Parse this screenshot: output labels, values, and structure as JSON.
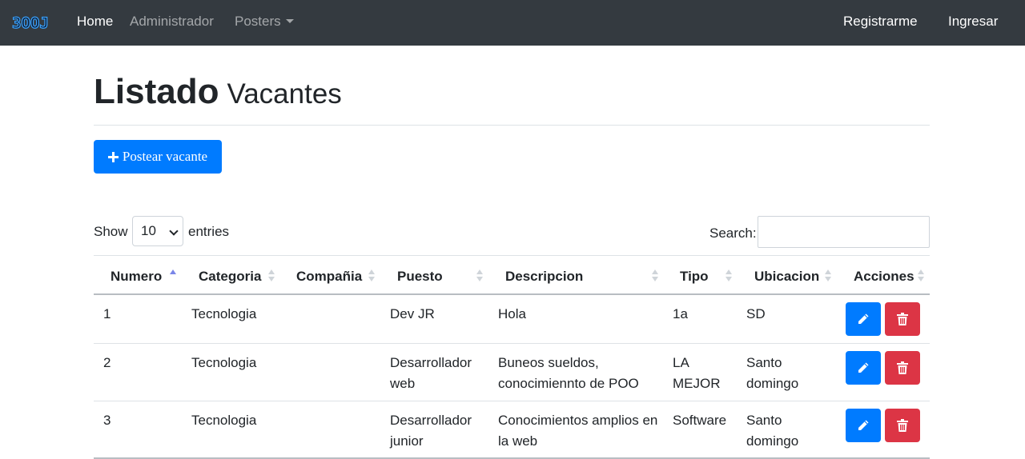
{
  "navbar": {
    "brand": "3OOJ",
    "links": {
      "home": "Home",
      "admin": "Administrador",
      "posters": "Posters"
    },
    "right": {
      "register": "Registrarme",
      "login": "Ingresar"
    }
  },
  "page": {
    "title": "Listado",
    "subtitle": "Vacantes",
    "post_button": "Postear vacante"
  },
  "table_controls": {
    "show_label": "Show",
    "entries_value": "10",
    "entries_label": "entries",
    "search_label": "Search:",
    "search_value": ""
  },
  "table": {
    "headers": [
      "Numero",
      "Categoria",
      "Compañia",
      "Puesto",
      "Descripcion",
      "Tipo",
      "Ubicacion",
      "Acciones"
    ],
    "sorted_column": "Numero",
    "rows": [
      {
        "numero": "1",
        "categoria": "Tecnologia",
        "compania": "",
        "puesto": "Dev JR",
        "descripcion": "Hola",
        "tipo": "1a",
        "ubicacion": "SD"
      },
      {
        "numero": "2",
        "categoria": "Tecnologia",
        "compania": "",
        "puesto": "Desarrollador web",
        "descripcion": "Buneos sueldos, conocimiennto de POO",
        "tipo": "LA MEJOR",
        "ubicacion": "Santo domingo"
      },
      {
        "numero": "3",
        "categoria": "Tecnologia",
        "compania": "",
        "puesto": "Desarrollador junior",
        "descripcion": "Conocimientos amplios en la web",
        "tipo": "Software",
        "ubicacion": "Santo domingo"
      }
    ]
  },
  "icons": {
    "post": "plus-icon",
    "edit": "pencil-icon",
    "delete": "trash-icon",
    "sort": "sort-icon"
  },
  "colors": {
    "navbar": "#343a40",
    "primary": "#007bff",
    "danger": "#dc3545"
  }
}
